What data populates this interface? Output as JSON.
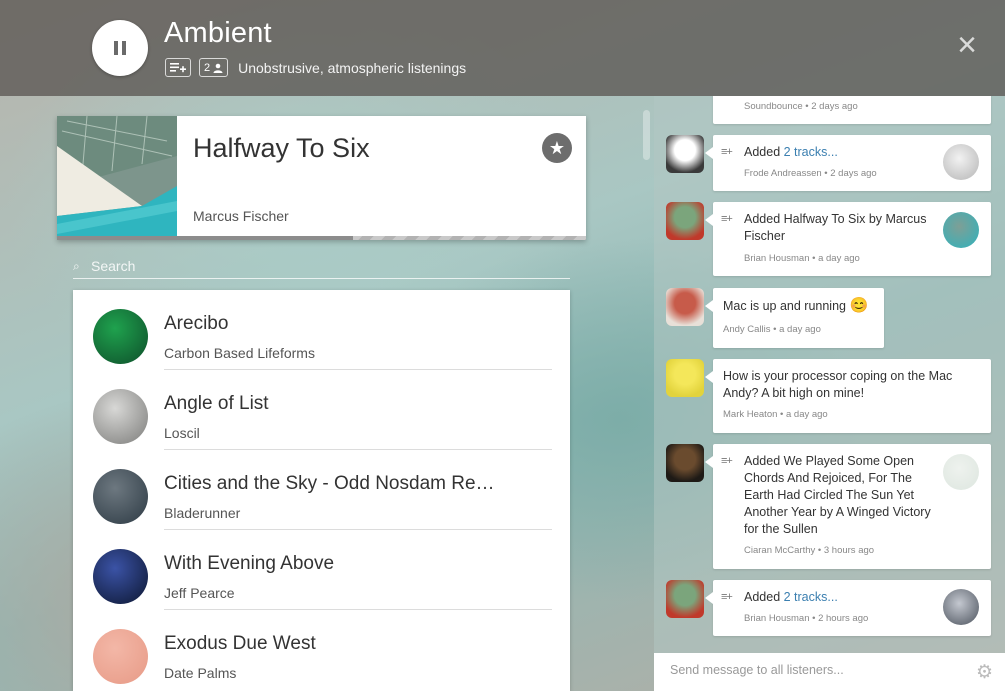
{
  "header": {
    "title": "Ambient",
    "queue_chip_icon": "queue-add-icon",
    "listeners_count": "2",
    "listeners_icon": "person-icon",
    "description": "Unobstrusive, atmospheric listenings",
    "close_label": "×"
  },
  "now_playing": {
    "title": "Halfway To Six",
    "artist": "Marcus Fischer",
    "star_icon": "★",
    "progress": 0.56
  },
  "search": {
    "icon": "⌕",
    "placeholder": "Search"
  },
  "tracks": [
    {
      "title": "Arecibo",
      "artist": "Carbon Based Lifeforms",
      "colors": [
        "#1fa24e",
        "#0e4e2a"
      ]
    },
    {
      "title": "Angle of List",
      "artist": "Loscil",
      "colors": [
        "#d8d8d6",
        "#7c7c7a"
      ]
    },
    {
      "title": "Cities and the Sky - Odd Nosdam Re…",
      "artist": "Bladerunner",
      "colors": [
        "#6d7880",
        "#2d3a44"
      ]
    },
    {
      "title": "With Evening Above",
      "artist": "Jeff Pearce",
      "colors": [
        "#3b53a6",
        "#0c1630"
      ]
    },
    {
      "title": "Exodus Due West",
      "artist": "Date Palms",
      "colors": [
        "#f3b7a7",
        "#e79a86"
      ]
    }
  ],
  "feed": [
    {
      "meta": "Soundbounce • 2 days ago"
    },
    {
      "prefix": "Added ",
      "link": "2 tracks...",
      "meta": "Frode Andreassen • 2 days ago",
      "avatar_colors": [
        "#ffffff",
        "#3a3a3a"
      ],
      "art_colors": [
        "#f2f2f2",
        "#b5b5b5"
      ]
    },
    {
      "prefix": "Added Halfway To Six by Marcus Fischer",
      "meta": "Brian Housman • a day ago",
      "avatar_colors": [
        "#7ba57c",
        "#c0392b"
      ],
      "art_colors": [
        "#7e9f96",
        "#2fb3bd"
      ]
    },
    {
      "text": "Mac is up and running",
      "emoji": "😊",
      "meta": "Andy Callis • a day ago",
      "avatar_colors": [
        "#c75b4a",
        "#e8e0d8"
      ]
    },
    {
      "text": "How is your processor coping on the Mac Andy? A bit high on mine!",
      "meta": "Mark Heaton • a day ago",
      "avatar_colors": [
        "#f4e75a",
        "#e2d33c"
      ]
    },
    {
      "prefix": "Added We Played Some Open Chords And Rejoiced, For The Earth Had Circled The Sun Yet Another Year by A Winged Victory for the Sullen",
      "meta": "Ciaran McCarthy • 3 hours ago",
      "avatar_colors": [
        "#6a4b2e",
        "#1e1a16"
      ],
      "art_colors": [
        "#eef2ee",
        "#dde6df"
      ]
    },
    {
      "prefix": "Added ",
      "link": "2 tracks...",
      "meta": "Brian Housman • 2 hours ago",
      "avatar_colors": [
        "#7ba57c",
        "#c0392b"
      ],
      "art_colors": [
        "#c4c8d0",
        "#4b525c"
      ]
    }
  ],
  "message": {
    "placeholder": "Send message to all listeners...",
    "settings_icon": "⚙"
  }
}
